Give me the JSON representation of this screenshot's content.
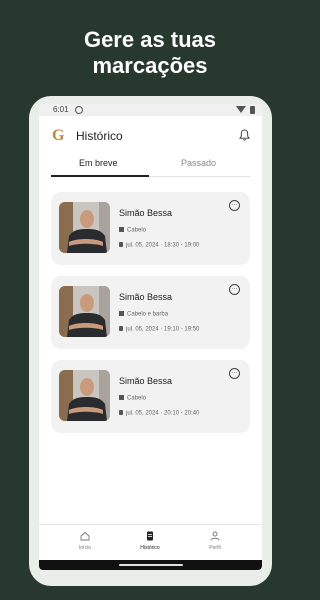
{
  "headline": {
    "line1": "Gere as tuas",
    "line2": "marcações"
  },
  "status_bar": {
    "time": "6:01"
  },
  "app_bar": {
    "title": "Histórico",
    "logo": "G"
  },
  "tabs": [
    {
      "label": "Em breve",
      "active": true
    },
    {
      "label": "Passado",
      "active": false
    }
  ],
  "appointments": [
    {
      "name": "Simão Bessa",
      "service": "Cabelo",
      "datetime": "jul. 05, 2024 · 18:30 - 19:00"
    },
    {
      "name": "Simão Bessa",
      "service": "Cabelo e barba",
      "datetime": "jul. 05, 2024 · 19:10 - 19:50"
    },
    {
      "name": "Simão Bessa",
      "service": "Cabelo",
      "datetime": "jul. 05, 2024 · 20:10 - 20:40"
    }
  ],
  "more_glyph": "···",
  "bottom_nav": [
    {
      "label": "Início",
      "icon": "home-icon"
    },
    {
      "label": "Histórico",
      "icon": "history-icon"
    },
    {
      "label": "Perfil",
      "icon": "profile-icon"
    }
  ],
  "colors": {
    "background": "#27382f",
    "logo": "#b78a3c",
    "card": "#f2f2f2"
  }
}
